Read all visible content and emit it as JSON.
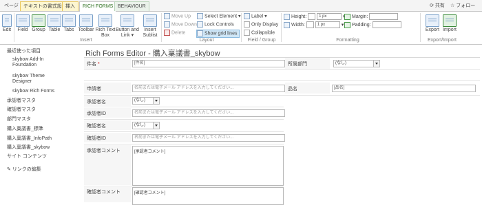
{
  "tabs": [
    {
      "label": "ページ"
    },
    {
      "label": "テキストの書式設定"
    },
    {
      "label": "挿入"
    },
    {
      "label": "RICH FORMS"
    },
    {
      "label": "BEHAVIOUR"
    }
  ],
  "topright": {
    "share": "共有",
    "follow": "フォロー"
  },
  "ribbon": {
    "edit": "Edit",
    "field": "Field",
    "group": "Group",
    "table": "Table",
    "tabs": "Tabs",
    "toolbar": "Toolbar",
    "rich_text_box": "Rich Text Box",
    "button_and_link": "Button and Link",
    "insert_sublist": "Insert Sublist",
    "move_up": "Move Up",
    "move_down": "Move Down",
    "delete": "Delete",
    "select_element": "Select Element",
    "lock_controls": "Lock Controls",
    "show_grid_lines": "Show grid lines",
    "label": "Label",
    "only_display": "Only Display",
    "collapsible": "Collapsible",
    "height": "Height:",
    "width": "Width:",
    "height_value": "1 px",
    "width_value": "1 px",
    "margin": "Margin:",
    "padding": "Padding:",
    "export": "Export",
    "import": "Import",
    "groups": {
      "insert": "Insert",
      "layout": "Layout",
      "field_group": "Field / Group",
      "formatting": "Formatting",
      "export_import": "Export/Import"
    }
  },
  "nav": {
    "recent": "最近使った項目",
    "items": [
      "skybow Add-In Foundation",
      "skybow Theme Designer",
      "skybow Rich Forms",
      "承認者マスタ",
      "確認者マスタ",
      "部門マスタ",
      "購入稟議書_標準",
      "購入稟議書_InfoPath",
      "購入稟議書_skybow",
      "サイト コンテンツ"
    ],
    "edit_links": "リンクの編集"
  },
  "page_title": "Rich Forms Editor - 購入稟議書_skybow",
  "form": {
    "subject_label": "件名",
    "required": "*",
    "subject_value": "[件名]",
    "dept_label": "所属部門",
    "dept_value": "(なし)",
    "applicant_label": "申請者",
    "people_placeholder": "名前または電子メール アドレスを入力してください...",
    "product_label": "品名",
    "product_value": "[品名]",
    "approver_name_label": "承認者名",
    "none": "(なし)",
    "approver_id_label": "承認者ID",
    "checker_name_label": "確認者名",
    "checker_id_label": "確認者ID",
    "approver_comment_label": "承認者コメント",
    "approver_comment_value": "[承認者コメント]",
    "checker_comment_label": "確認者コメント",
    "checker_comment_value": "[確認者コメント]"
  }
}
